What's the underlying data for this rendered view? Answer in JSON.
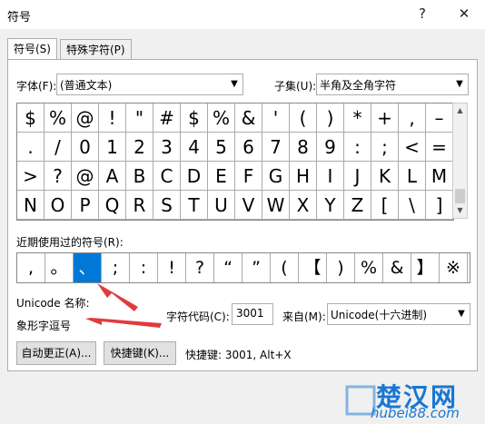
{
  "window": {
    "title": "符号",
    "help_button": "?",
    "close_button": "✕"
  },
  "tabs": [
    {
      "label": "符号(S)"
    },
    {
      "label": "特殊字符(P)"
    }
  ],
  "font": {
    "label": "字体(F):",
    "value": "(普通文本)"
  },
  "subset": {
    "label": "子集(U):",
    "value": "半角及全角字符"
  },
  "symbol_grid": [
    [
      "$",
      "%",
      "@",
      "!",
      "\"",
      "#",
      "$",
      "%",
      "&",
      "'",
      "(",
      ")",
      "*",
      "+",
      ",",
      "–"
    ],
    [
      ".",
      "/",
      "0",
      "1",
      "2",
      "3",
      "4",
      "5",
      "6",
      "7",
      "8",
      "9",
      ":",
      ";",
      "<",
      "="
    ],
    [
      ">",
      "?",
      "@",
      "A",
      "B",
      "C",
      "D",
      "E",
      "F",
      "G",
      "H",
      "I",
      "J",
      "K",
      "L",
      "M"
    ],
    [
      "N",
      "O",
      "P",
      "Q",
      "R",
      "S",
      "T",
      "U",
      "V",
      "W",
      "X",
      "Y",
      "Z",
      "[",
      "\\",
      "]"
    ]
  ],
  "recent": {
    "label": "近期使用过的符号(R):",
    "symbols": [
      ",",
      "。",
      "、",
      ";",
      ":",
      "!",
      "?",
      "“",
      "”",
      "(",
      "【",
      ")",
      "%",
      "&",
      "】",
      "※"
    ],
    "selected_index": 2
  },
  "unicode_name": {
    "label": "Unicode 名称:",
    "value": "象形字逗号"
  },
  "char_code": {
    "label": "字符代码(C):",
    "value": "3001"
  },
  "from": {
    "label": "来自(M):",
    "value": "Unicode(十六进制)"
  },
  "buttons": {
    "autocorrect": "自动更正(A)...",
    "shortcut_key": "快捷键(K)..."
  },
  "shortcut_info": "快捷键: 3001, Alt+X",
  "watermark": {
    "text": "楚汉网",
    "url": "hubei88.com"
  },
  "colors": {
    "selection": "#0078d7",
    "arrow": "#e03c3c"
  }
}
